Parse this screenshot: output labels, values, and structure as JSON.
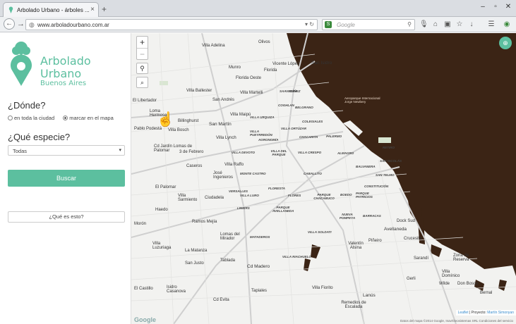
{
  "browser": {
    "tab_title": "Arbolado Urbano - árboles ...",
    "tab_close": "×",
    "new_tab": "+",
    "url": "www.arboladourbano.com.ar",
    "search_placeholder": "Google",
    "search_engine_letter": "S"
  },
  "sidebar": {
    "brand_line1": "Arbolado",
    "brand_line2": "Urbano",
    "brand_line3": "Buenos Aires",
    "where_heading": "¿Dónde?",
    "where_options": [
      "en toda la ciudad",
      "marcar en el mapa"
    ],
    "where_selected": "marcar en el mapa",
    "species_heading": "¿Qué especie?",
    "species_selected": "Todas",
    "search_button": "Buscar",
    "about_button": "¿Qué es esto?"
  },
  "map": {
    "zoom_in": "+",
    "zoom_out": "−",
    "attribution_prefix": "Leaflet",
    "attribution_sep": " | Proyecto: ",
    "attribution_author": "Martín Simonyan",
    "footer_text": "Datos del mapa ©2014 Google, Inav/Geosistemas SRL   Condiciones del servicio",
    "google_logo": "Google",
    "labels": [
      "Olivos",
      "Villa Adelina",
      "San Isidro",
      "Vicente López",
      "Munro",
      "Florida",
      "Florida Oeste",
      "Villa Martelli",
      "Villa Ballester",
      "San Andrés",
      "El Libertador",
      "Billinghurst",
      "Villa Maipú",
      "San Martín",
      "Villa Bosch",
      "Pablo Podestá",
      "Loma Hermosa",
      "Villa Lynch",
      "3 de Febrero",
      "Cd Jardín Lomas de Palomar",
      "Caseros",
      "Villa Raffo",
      "José Ingenieros",
      "El Palomar",
      "Villa Sarmiento",
      "Ciudadela",
      "Haedo",
      "Ramos Mejía",
      "Morón",
      "Lomas del Mirador",
      "La Matanza",
      "Villa Luzuriaga",
      "San Justo",
      "Tablada",
      "Cd Madero",
      "El Castillo",
      "Isidro Casanova",
      "Cd Evita",
      "Tapiales",
      "Villa Fiorito",
      "Lanús",
      "Remedios de Escalada",
      "Gerli",
      "Avellaneda",
      "Piñeiro",
      "Crucesita",
      "Valentín Alsina",
      "Dock Sud",
      "Sarandí",
      "Villa Domínico",
      "Wilde",
      "Don Bosco",
      "Bernal",
      "Zona de Reserva"
    ],
    "hoods": [
      "SAAVEDRA",
      "NÚÑEZ",
      "COGHLAN",
      "BELGRANO",
      "VILLA URQUIZA",
      "VILLA PUEYRREDÓN",
      "VILLA ORTÚZAR",
      "COLEGIALES",
      "CHACARITA",
      "PALERMO",
      "AGRONOMÍA",
      "VILLA DEVOTO",
      "VILLA DEL PARQUE",
      "VILLA CRESPO",
      "ALMAGRO",
      "BALVANERA",
      "RETIRO",
      "SAN NICOLÁS",
      "SAN TELMO",
      "MONTE CASTRO",
      "CABALLITO",
      "FLORESTA",
      "VERSALLES",
      "VILLA LURO",
      "FLORES",
      "PARQUE CHACABUCO",
      "BOEDO",
      "PARQUE PATRICIOS",
      "CONSTITUCIÓN",
      "LINIERS",
      "PARQUE AVELLANEDA",
      "NUEVA POMPEYA",
      "BARRACAS",
      "MATADEROS",
      "VILLA SOLDATI",
      "VILLA RIACHUELO"
    ],
    "river_label": "Aeroparque Internacional Jorge Newbery"
  }
}
